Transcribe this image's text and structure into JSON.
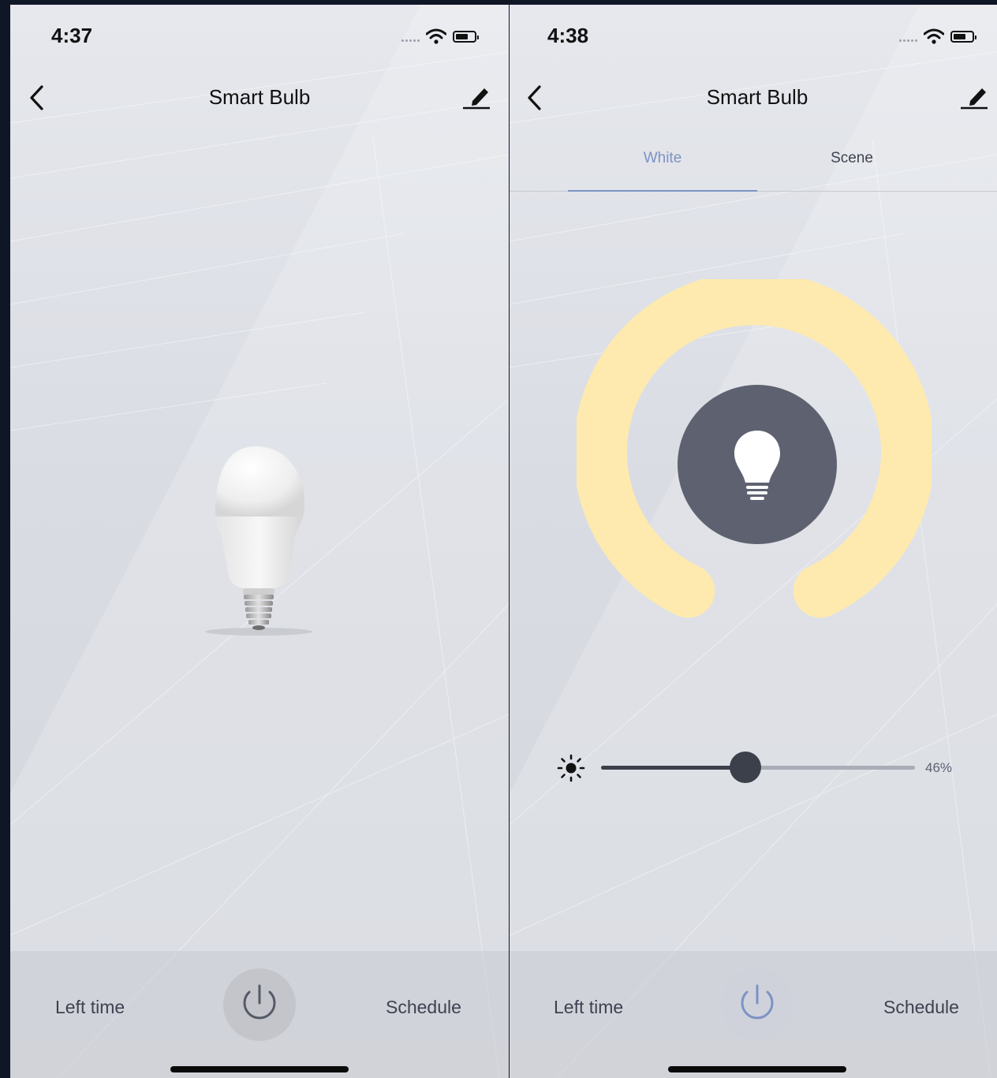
{
  "left_screen": {
    "status_time": "4:37",
    "title": "Smart Bulb",
    "bottom_bar": {
      "left_label": "Left time",
      "right_label": "Schedule",
      "power_state": "off",
      "power_icon": "power-icon"
    }
  },
  "right_screen": {
    "status_time": "4:38",
    "title": "Smart Bulb",
    "tabs": [
      {
        "label": "White",
        "active": true
      },
      {
        "label": "Scene",
        "active": false
      }
    ],
    "dial": {
      "ring_color": "#feeaae",
      "center_color": "#5e6270",
      "icon": "lightbulb-icon"
    },
    "brightness": {
      "value_label": "46%",
      "fraction": 0.46,
      "icon": "brightness-sun-icon"
    },
    "bottom_bar": {
      "left_label": "Left time",
      "right_label": "Schedule",
      "power_state": "on",
      "power_icon": "power-icon"
    }
  },
  "colors": {
    "accent_blue": "#7d93c4",
    "warm_yellow": "#feeaae"
  }
}
